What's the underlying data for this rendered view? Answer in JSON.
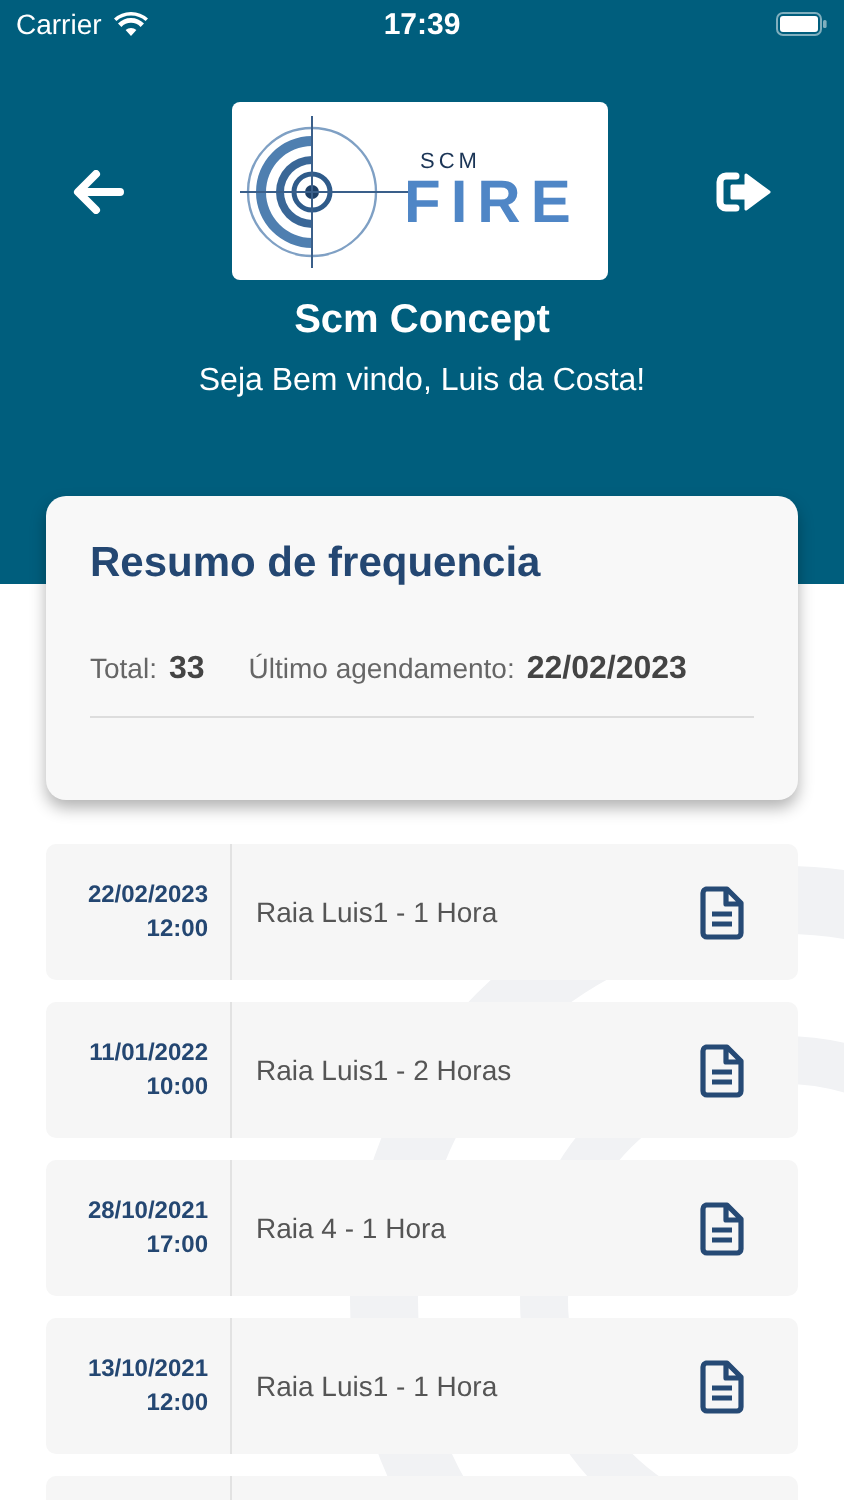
{
  "status_bar": {
    "carrier": "Carrier",
    "time": "17:39"
  },
  "header": {
    "logo": {
      "top": "SCM",
      "bottom": "FIRE"
    },
    "title": "Scm Concept",
    "subtitle": "Seja Bem vindo, Luis da Costa!"
  },
  "summary": {
    "title": "Resumo de frequencia",
    "total_label": "Total:",
    "total": "33",
    "last_label": "Último agendamento:",
    "last": "22/02/2023"
  },
  "bookings": [
    {
      "date": "22/02/2023",
      "time": "12:00",
      "description": "Raia Luis1 - 1 Hora"
    },
    {
      "date": "11/01/2022",
      "time": "10:00",
      "description": "Raia Luis1 - 2 Horas"
    },
    {
      "date": "28/10/2021",
      "time": "17:00",
      "description": "Raia 4 - 1 Hora"
    },
    {
      "date": "13/10/2021",
      "time": "12:00",
      "description": "Raia Luis1 - 1 Hora"
    }
  ]
}
